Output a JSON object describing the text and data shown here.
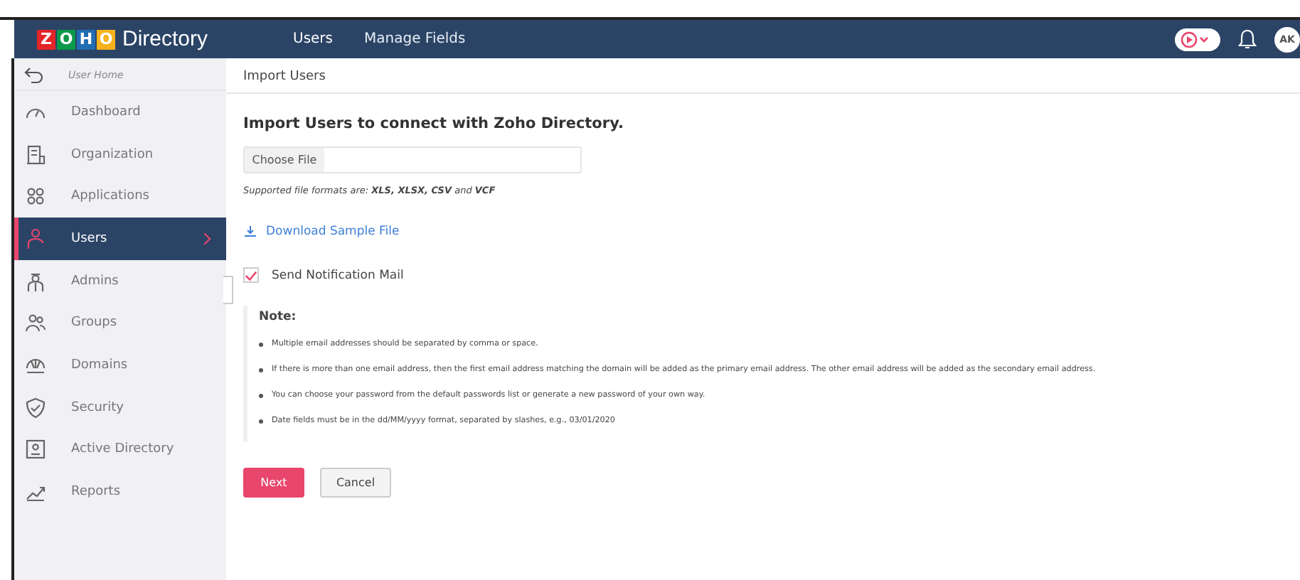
{
  "header": {
    "logo_letters": [
      {
        "char": "Z",
        "color": "#e42527"
      },
      {
        "char": "O",
        "color": "#089949"
      },
      {
        "char": "H",
        "color": "#226db4"
      },
      {
        "char": "O",
        "color": "#f9b21d"
      }
    ],
    "app_name": "Directory",
    "nav": [
      {
        "label": "Users",
        "selected": true
      },
      {
        "label": "Manage Fields",
        "selected": false
      }
    ],
    "avatar": "AK"
  },
  "sidebar": {
    "back": {
      "label": "User Home"
    },
    "items": [
      {
        "label": "Dashboard",
        "selected": false
      },
      {
        "label": "Organization",
        "selected": false
      },
      {
        "label": "Applications",
        "selected": false
      },
      {
        "label": "Users",
        "selected": true
      },
      {
        "label": "Admins",
        "selected": false
      },
      {
        "label": "Groups",
        "selected": false
      },
      {
        "label": "Domains",
        "selected": false
      },
      {
        "label": "Security",
        "selected": false
      },
      {
        "label": "Active Directory",
        "selected": false
      },
      {
        "label": "Reports",
        "selected": false
      }
    ]
  },
  "page": {
    "breadcrumb": "Import Users",
    "heading": "Import Users to connect with Zoho Directory.",
    "file_button": "Choose File",
    "formats": "Supported file formats are: **XLS, XLSX, CSV** and **VCF**",
    "download_link": "Download Sample File",
    "notify": {
      "label": "Send Notification Mail",
      "checked": true
    },
    "note": {
      "title": "Note:",
      "items": [
        "Multiple email addresses should be separated by comma or space.",
        "If there is more than one email address, then the first email address matching the domain will be added as the primary email address. The other email address will be added as the secondary email address.",
        "You can choose your password from the default passwords list or generate a new password of your own way.",
        "Date fields must be in the dd/MM/yyyy format, separated by slashes, e.g., 03/01/2020"
      ]
    },
    "buttons": [
      {
        "label": "Next",
        "kind": "primary"
      },
      {
        "label": "Cancel",
        "kind": "secondary"
      }
    ]
  }
}
